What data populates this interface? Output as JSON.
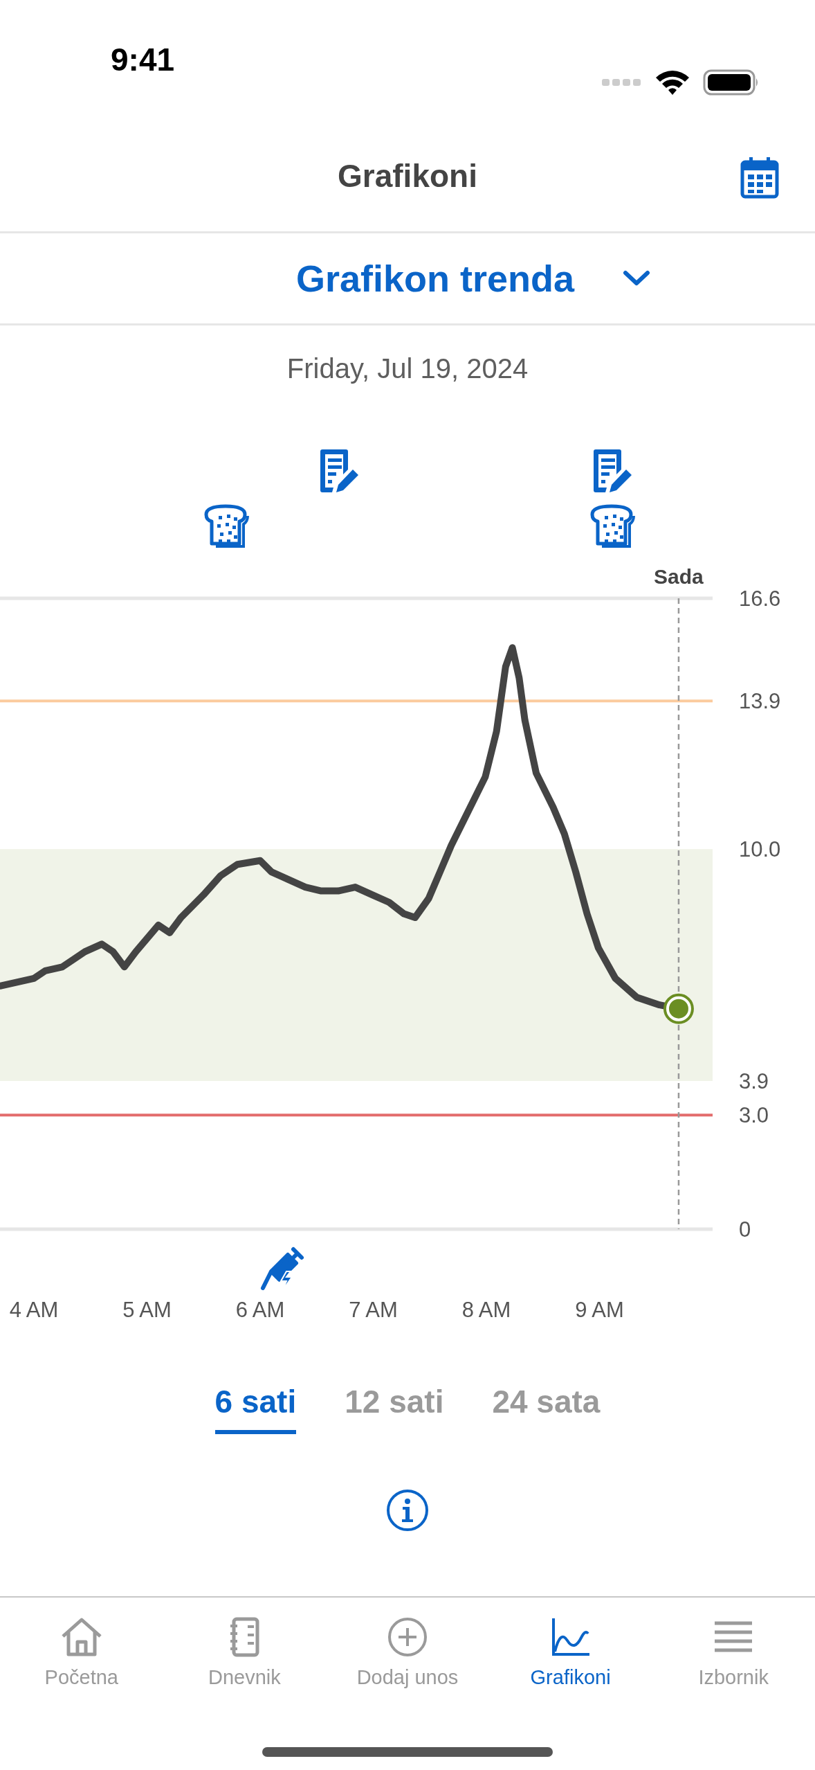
{
  "status_bar": {
    "time": "9:41"
  },
  "header": {
    "title": "Grafikoni"
  },
  "chart_selector": {
    "label": "Grafikon trenda"
  },
  "date": "Friday, Jul 19, 2024",
  "chart": {
    "chart_data": {
      "type": "line",
      "x": [
        3.7,
        4.0,
        4.1,
        4.25,
        4.35,
        4.45,
        4.6,
        4.7,
        4.8,
        4.9,
        5.1,
        5.2,
        5.3,
        5.5,
        5.65,
        5.8,
        6.0,
        6.1,
        6.25,
        6.4,
        6.54,
        6.69,
        6.84,
        6.99,
        7.14,
        7.27,
        7.37,
        7.49,
        7.59,
        7.69,
        7.84,
        7.99,
        8.09,
        8.17,
        8.23,
        8.29,
        8.34,
        8.44,
        8.59,
        8.69,
        8.79,
        8.89,
        8.99,
        9.14,
        9.33,
        9.53,
        9.7
      ],
      "series": [
        {
          "color": "#444444",
          "values": [
            6.4,
            6.6,
            6.8,
            6.9,
            7.1,
            7.3,
            7.5,
            7.3,
            6.9,
            7.3,
            8.0,
            7.8,
            8.2,
            8.8,
            9.3,
            9.6,
            9.7,
            9.4,
            9.2,
            9.0,
            8.9,
            8.9,
            9.0,
            8.8,
            8.6,
            8.3,
            8.2,
            8.7,
            9.4,
            10.1,
            11.0,
            11.9,
            13.1,
            14.8,
            15.3,
            14.5,
            13.4,
            12.0,
            11.1,
            10.4,
            9.4,
            8.3,
            7.4,
            6.6,
            6.1,
            5.9,
            5.8
          ]
        }
      ],
      "xlim": [
        3.7,
        10.0
      ],
      "ylim": [
        0,
        16.6
      ],
      "xticks": [
        {
          "value": 4,
          "label": "4 AM"
        },
        {
          "value": 5,
          "label": "5 AM"
        },
        {
          "value": 6,
          "label": "6 AM"
        },
        {
          "value": 7,
          "label": "7 AM"
        },
        {
          "value": 8,
          "label": "8 AM"
        },
        {
          "value": 9,
          "label": "9 AM"
        }
      ],
      "yticks": [
        {
          "value": 0,
          "label": "0"
        },
        {
          "value": 3,
          "label": "3.0"
        },
        {
          "value": 3.9,
          "label": "3.9"
        },
        {
          "value": 10,
          "label": "10.0"
        },
        {
          "value": 13.9,
          "label": "13.9"
        },
        {
          "value": 16.6,
          "label": "16.6"
        }
      ],
      "bands": [
        {
          "axis": "y",
          "from": 3.9,
          "to": 10.0,
          "color": "#f0f3e8"
        }
      ],
      "ref_lines": [
        {
          "axis": "y",
          "value": 13.9,
          "color": "#fbcb9e"
        },
        {
          "axis": "y",
          "value": 3.0,
          "color": "#e36c6c"
        },
        {
          "axis": "x",
          "value": 9.7,
          "color": "#999999",
          "label": "Sada"
        }
      ]
    },
    "events": [
      {
        "kind": "note"
      },
      {
        "kind": "note"
      },
      {
        "kind": "food"
      },
      {
        "kind": "food"
      },
      {
        "kind": "insulin"
      }
    ]
  },
  "range_tabs": [
    {
      "label": "6 sati",
      "selected": true
    },
    {
      "label": "12 sati",
      "selected": false
    },
    {
      "label": "24 sata",
      "selected": false
    }
  ],
  "nav": [
    {
      "label": "Početna",
      "selected": false
    },
    {
      "label": "Dnevnik",
      "selected": false
    },
    {
      "label": "Dodaj unos",
      "selected": false
    },
    {
      "label": "Grafikoni",
      "selected": true
    },
    {
      "label": "Izbornik",
      "selected": false
    }
  ]
}
